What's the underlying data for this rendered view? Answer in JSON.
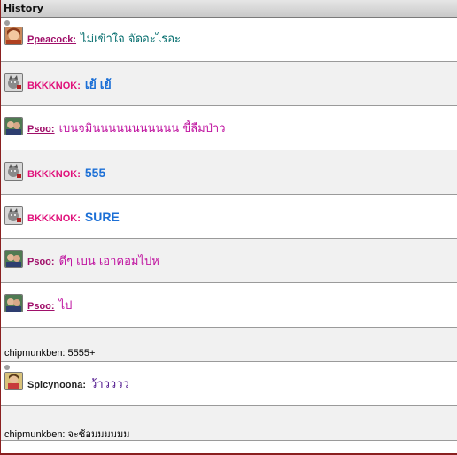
{
  "window": {
    "title": "History"
  },
  "colors": {
    "name_magenta": "#a0106a",
    "name_pink": "#e0107a",
    "name_dark": "#222222",
    "msg_teal": "#006b6b",
    "msg_blue": "#1b6fd6",
    "msg_magenta": "#c015a0",
    "msg_purple": "#4a0f8a",
    "msg_black": "#000000"
  },
  "entries": [
    {
      "user": "Ppeacock:",
      "avatar": "girl-avatar-icon",
      "message": "ไม่เข้าใจ จัดอะไรอะ"
    },
    {
      "user": "BKKKNOK:",
      "avatar": "cat-avatar-icon",
      "message": "เย้ เย้"
    },
    {
      "user": "Psoo:",
      "avatar": "couple-avatar-icon",
      "message": "เบนจมินนนนนนนนนนน ขี้ลืมป่าว"
    },
    {
      "user": "BKKKNOK:",
      "avatar": "cat-avatar-icon",
      "message": "555"
    },
    {
      "user": "BKKKNOK:",
      "avatar": "cat-avatar-icon",
      "message": "SURE"
    },
    {
      "user": "Psoo:",
      "avatar": "couple-avatar-icon",
      "message": "ดีๆ เบน เอาคอมไปห"
    },
    {
      "user": "Psoo:",
      "avatar": "couple-avatar-icon",
      "message": "ไป"
    },
    {
      "text": "chipmunkben: 5555+"
    },
    {
      "user": "Spicynoona:",
      "avatar": "woman-avatar-icon",
      "message": "ว้าวววว"
    },
    {
      "text": "chipmunkben: จะซ้อมมมมมม"
    }
  ]
}
